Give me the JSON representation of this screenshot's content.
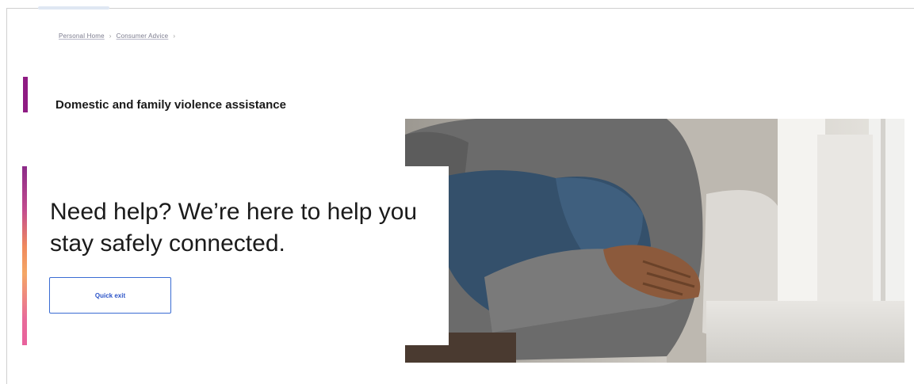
{
  "breadcrumb": {
    "items": [
      "Personal Home",
      "Consumer Advice"
    ],
    "separator": "›"
  },
  "section": {
    "heading": "Domestic and family violence assistance",
    "accent_color": "#8f1b83"
  },
  "hero": {
    "title": "Need help? We’re here to help you stay safely connected.",
    "button_label": "Quick exit",
    "image_alt": "Person sitting hugging their knees"
  }
}
